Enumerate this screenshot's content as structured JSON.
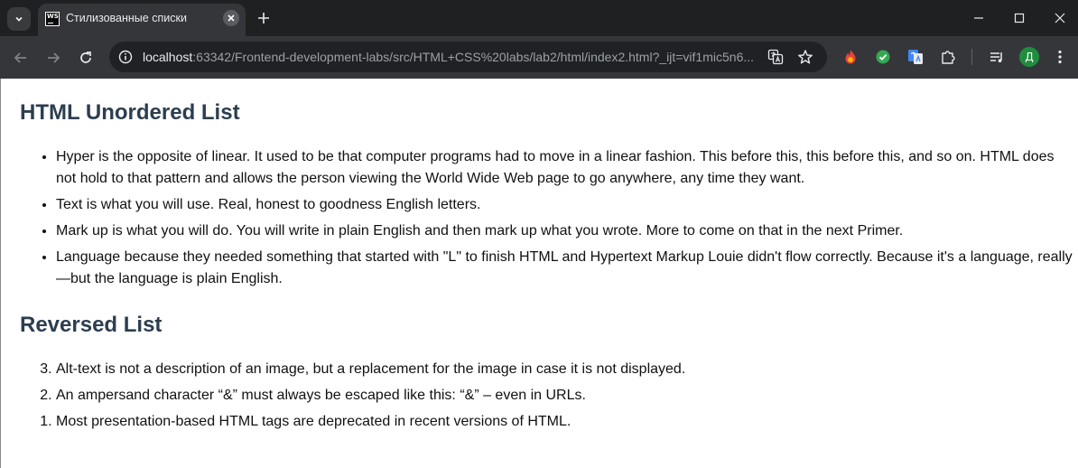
{
  "browser": {
    "tab_title": "Стилизованные списки",
    "tab_favicon_text": "WS",
    "url_host": "localhost",
    "url_rest": ":63342/Frontend-development-labs/src/HTML+CSS%20labs/lab2/html/index2.html?_ijt=vif1mic5n6...",
    "profile_initial": "Д",
    "icons": {
      "tab_menu": "chevron-down-icon",
      "tab_close": "close-icon",
      "new_tab": "plus-icon",
      "minimize": "minimize-icon",
      "maximize": "maximize-icon",
      "close_window": "close-icon",
      "back": "arrow-left-icon",
      "forward": "arrow-right-icon",
      "reload": "reload-icon",
      "site_info": "info-icon",
      "translate": "translate-icon",
      "bookmark": "star-icon",
      "extensions": [
        "flame-icon",
        "check-circle-icon",
        "google-translate-icon",
        "puzzle-icon"
      ],
      "media": "playlist-icon",
      "menu": "kebab-menu-icon"
    },
    "colors": {
      "tabstrip": "#1f2021",
      "toolbar": "#35363a",
      "omnibox": "#202124",
      "avatar": "#1e8e3e"
    }
  },
  "page": {
    "heading_unordered": "HTML Unordered List",
    "unordered_items": [
      "Hyper is the opposite of linear. It used to be that computer programs had to move in a linear fashion. This before this, this before this, and so on. HTML does not hold to that pattern and allows the person viewing the World Wide Web page to go anywhere, any time they want.",
      "Text is what you will use. Real, honest to goodness English letters.",
      "Mark up is what you will do. You will write in plain English and then mark up what you wrote. More to come on that in the next Primer.",
      "Language because they needed something that started with \"L\" to finish HTML and Hypertext Markup Louie didn't flow correctly. Because it's a language, really—but the language is plain English."
    ],
    "heading_reversed": "Reversed List",
    "reversed_items": [
      "Alt-text is not a description of an image, but a replacement for the image in case it is not displayed.",
      "An ampersand character “&” must always be escaped like this: “&” – even in URLs.",
      "Most presentation-based HTML tags are deprecated in recent versions of HTML."
    ],
    "colors": {
      "heading": "#2c3e50",
      "text": "#111111"
    }
  }
}
